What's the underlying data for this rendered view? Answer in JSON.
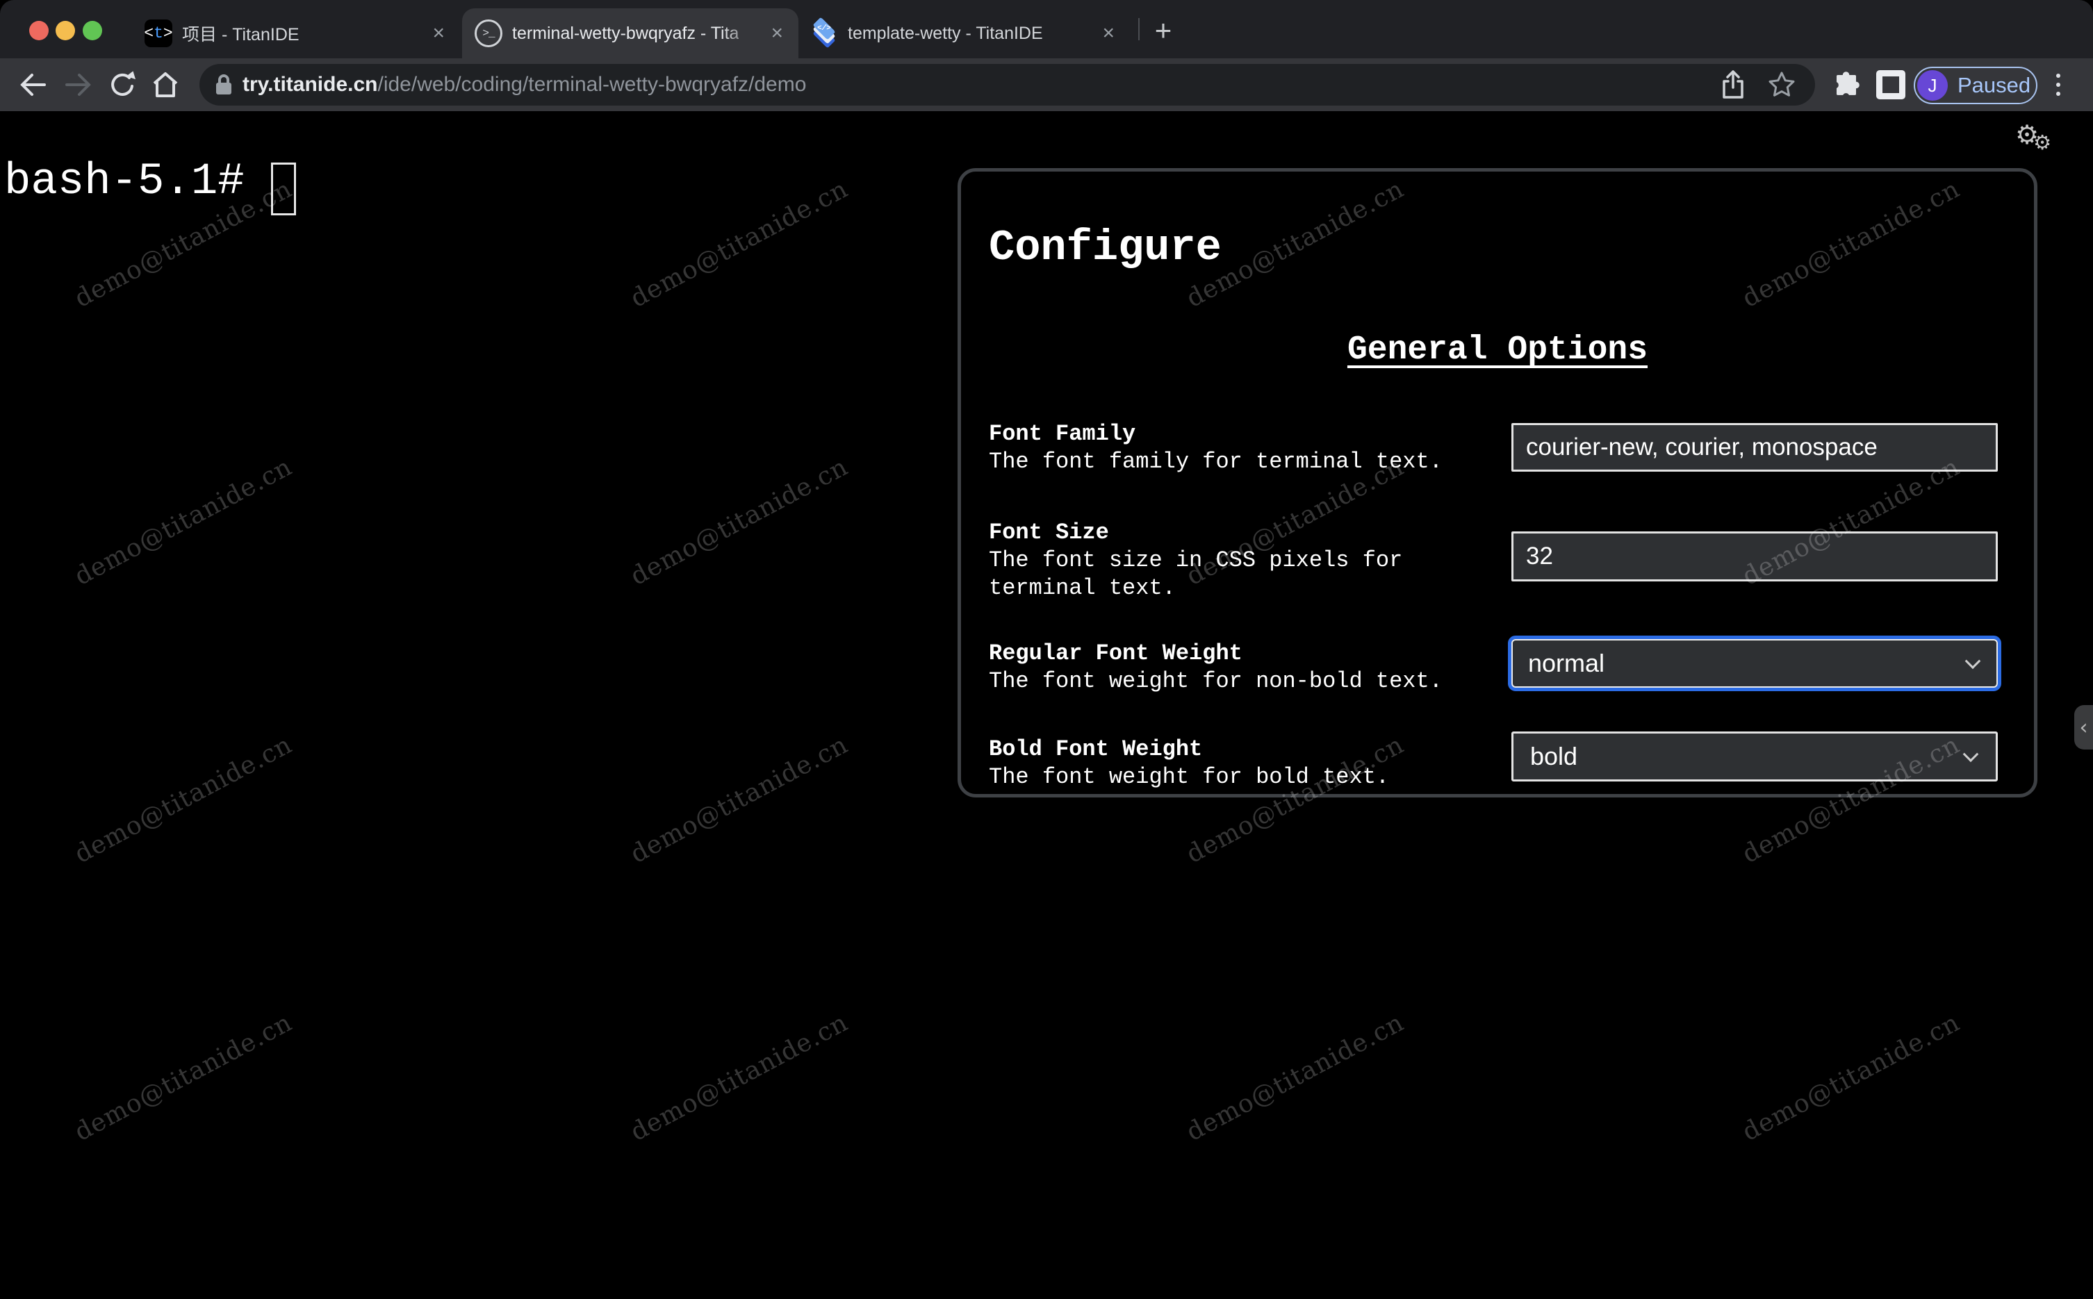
{
  "browser": {
    "tabs": [
      {
        "title": "项目 - TitanIDE",
        "close_glyph": "×"
      },
      {
        "title": "terminal-wetty-bwqryafz - Tita",
        "close_glyph": "×"
      },
      {
        "title": "template-wetty - TitanIDE",
        "close_glyph": "×"
      }
    ],
    "new_tab_glyph": "+",
    "urlbar": {
      "host": "try.titanide.cn",
      "path": "/ide/web/coding/terminal-wetty-bwqryafz/demo"
    },
    "profile": {
      "initial": "J",
      "status": "Paused"
    }
  },
  "terminal": {
    "prompt": "bash-5.1#"
  },
  "watermark": {
    "text": "demo@titanide.cn"
  },
  "page_icons": {
    "gear_glyph": "⚙",
    "collapse_glyph": "‹",
    "stack_code_glyph": "</>"
  },
  "favicon_t": {
    "open": "<",
    "letter": "t",
    "close": ">"
  },
  "terminal_favicon_glyph": ">_",
  "configure": {
    "title": "Configure",
    "section": "General Options",
    "fields": [
      {
        "label": "Font Family",
        "description": "The font family for terminal text.",
        "control": "input",
        "value": "courier-new, courier, monospace"
      },
      {
        "label": "Font Size",
        "description": "The font size in CSS pixels for terminal text.",
        "control": "input",
        "value": "32"
      },
      {
        "label": "Regular Font Weight",
        "description": "The font weight for non-bold text.",
        "control": "select",
        "value": "normal",
        "focused": true
      },
      {
        "label": "Bold Font Weight",
        "description": "The font weight for bold text.",
        "control": "select",
        "value": "bold",
        "focused": false
      }
    ]
  },
  "colors": {
    "focus_blue": "#2b6be4",
    "paused_blue": "#a8c7fa",
    "avatar_purple": "#6747d6",
    "toolbar_bg": "#35363a",
    "tabstrip_bg": "#202125",
    "terminal_bg": "#000000"
  }
}
